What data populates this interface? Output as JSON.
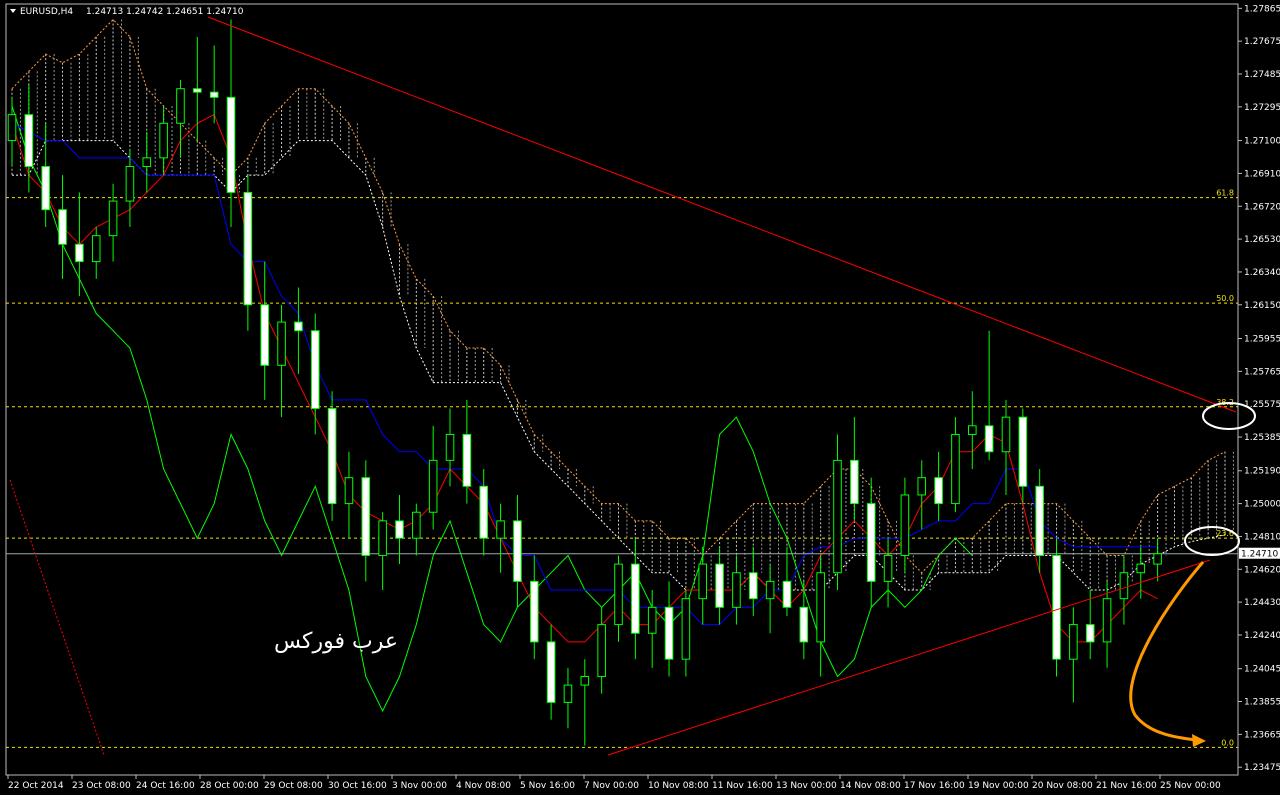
{
  "header": {
    "symbol": "EURUSD,H4",
    "ohlc": "1.24713 1.24742 1.24651 1.24710"
  },
  "watermark": "عرب فوركس",
  "colors": {
    "background": "#000000",
    "bull": "#ffffcc",
    "bear": "#ffffff",
    "kijun": "#0000ff",
    "tenkan": "#ff0000",
    "chikou": "#00ff00",
    "cloud": "#ffffff",
    "cloud_alt": "#ffa040",
    "fib": "#f2e500",
    "trend": "#ff0000",
    "arrow": "#ff9900",
    "circle": "#ffffff"
  },
  "chart_data": {
    "type": "candlestick",
    "y_ticks": [
      "1.27865",
      "1.27675",
      "1.27485",
      "1.27295",
      "1.27100",
      "1.26910",
      "1.26720",
      "1.26530",
      "1.26340",
      "1.26150",
      "1.25955",
      "1.25765",
      "1.25575",
      "1.25385",
      "1.25190",
      "1.25000",
      "1.24810",
      "1.24620",
      "1.24430",
      "1.24240",
      "1.24045",
      "1.23855",
      "1.23665",
      "1.23475"
    ],
    "ylim": [
      1.2343,
      1.2789
    ],
    "x_ticks": [
      "22 Oct 2014",
      "23 Oct 08:00",
      "24 Oct 16:00",
      "28 Oct 00:00",
      "29 Oct 08:00",
      "30 Oct 16:00",
      "3 Nov 00:00",
      "4 Nov 08:00",
      "5 Nov 16:00",
      "7 Nov 00:00",
      "10 Nov 08:00",
      "11 Nov 16:00",
      "13 Nov 00:00",
      "14 Nov 08:00",
      "17 Nov 16:00",
      "19 Nov 00:00",
      "20 Nov 08:00",
      "21 Nov 16:00",
      "25 Nov 00:00"
    ],
    "current_price": "1.24710",
    "fib_levels": [
      {
        "label": "61.8",
        "price": 1.2677
      },
      {
        "label": "50.0",
        "price": 1.2616
      },
      {
        "label": "38.2",
        "price": 1.2556
      },
      {
        "label": "23.6",
        "price": 1.248
      },
      {
        "label": "0.0",
        "price": 1.2359
      }
    ],
    "candles": [
      {
        "o": 1.271,
        "h": 1.2735,
        "l": 1.2695,
        "c": 1.2725
      },
      {
        "o": 1.2725,
        "h": 1.2742,
        "l": 1.268,
        "c": 1.2695
      },
      {
        "o": 1.2695,
        "h": 1.272,
        "l": 1.266,
        "c": 1.267
      },
      {
        "o": 1.267,
        "h": 1.269,
        "l": 1.263,
        "c": 1.265
      },
      {
        "o": 1.265,
        "h": 1.268,
        "l": 1.262,
        "c": 1.264
      },
      {
        "o": 1.264,
        "h": 1.266,
        "l": 1.263,
        "c": 1.2655
      },
      {
        "o": 1.2655,
        "h": 1.2685,
        "l": 1.264,
        "c": 1.2675
      },
      {
        "o": 1.2675,
        "h": 1.2705,
        "l": 1.266,
        "c": 1.2695
      },
      {
        "o": 1.2695,
        "h": 1.2715,
        "l": 1.268,
        "c": 1.27
      },
      {
        "o": 1.27,
        "h": 1.273,
        "l": 1.269,
        "c": 1.272
      },
      {
        "o": 1.272,
        "h": 1.2745,
        "l": 1.27,
        "c": 1.274
      },
      {
        "o": 1.274,
        "h": 1.277,
        "l": 1.271,
        "c": 1.2738
      },
      {
        "o": 1.2738,
        "h": 1.2765,
        "l": 1.272,
        "c": 1.2735
      },
      {
        "o": 1.2735,
        "h": 1.278,
        "l": 1.266,
        "c": 1.268
      },
      {
        "o": 1.268,
        "h": 1.269,
        "l": 1.26,
        "c": 1.2615
      },
      {
        "o": 1.2615,
        "h": 1.264,
        "l": 1.256,
        "c": 1.258
      },
      {
        "o": 1.258,
        "h": 1.2615,
        "l": 1.255,
        "c": 1.2605
      },
      {
        "o": 1.2605,
        "h": 1.2625,
        "l": 1.2575,
        "c": 1.26
      },
      {
        "o": 1.26,
        "h": 1.261,
        "l": 1.254,
        "c": 1.2555
      },
      {
        "o": 1.2555,
        "h": 1.2565,
        "l": 1.249,
        "c": 1.25
      },
      {
        "o": 1.25,
        "h": 1.253,
        "l": 1.248,
        "c": 1.2515
      },
      {
        "o": 1.2515,
        "h": 1.2525,
        "l": 1.2455,
        "c": 1.247
      },
      {
        "o": 1.247,
        "h": 1.2495,
        "l": 1.245,
        "c": 1.249
      },
      {
        "o": 1.249,
        "h": 1.2505,
        "l": 1.2465,
        "c": 1.248
      },
      {
        "o": 1.248,
        "h": 1.25,
        "l": 1.247,
        "c": 1.2495
      },
      {
        "o": 1.2495,
        "h": 1.2545,
        "l": 1.2485,
        "c": 1.2525
      },
      {
        "o": 1.2525,
        "h": 1.2555,
        "l": 1.251,
        "c": 1.254
      },
      {
        "o": 1.254,
        "h": 1.256,
        "l": 1.25,
        "c": 1.251
      },
      {
        "o": 1.251,
        "h": 1.252,
        "l": 1.247,
        "c": 1.248
      },
      {
        "o": 1.248,
        "h": 1.25,
        "l": 1.246,
        "c": 1.249
      },
      {
        "o": 1.249,
        "h": 1.2505,
        "l": 1.244,
        "c": 1.2455
      },
      {
        "o": 1.2455,
        "h": 1.247,
        "l": 1.241,
        "c": 1.242
      },
      {
        "o": 1.242,
        "h": 1.243,
        "l": 1.2375,
        "c": 1.2385
      },
      {
        "o": 1.2385,
        "h": 1.2405,
        "l": 1.237,
        "c": 1.2395
      },
      {
        "o": 1.2395,
        "h": 1.241,
        "l": 1.236,
        "c": 1.24
      },
      {
        "o": 1.24,
        "h": 1.244,
        "l": 1.239,
        "c": 1.243
      },
      {
        "o": 1.243,
        "h": 1.247,
        "l": 1.242,
        "c": 1.2465
      },
      {
        "o": 1.2465,
        "h": 1.248,
        "l": 1.241,
        "c": 1.2425
      },
      {
        "o": 1.2425,
        "h": 1.245,
        "l": 1.2405,
        "c": 1.244
      },
      {
        "o": 1.244,
        "h": 1.2455,
        "l": 1.24,
        "c": 1.241
      },
      {
        "o": 1.241,
        "h": 1.245,
        "l": 1.24,
        "c": 1.2445
      },
      {
        "o": 1.2445,
        "h": 1.2475,
        "l": 1.243,
        "c": 1.2465
      },
      {
        "o": 1.2465,
        "h": 1.2475,
        "l": 1.243,
        "c": 1.244
      },
      {
        "o": 1.244,
        "h": 1.247,
        "l": 1.243,
        "c": 1.246
      },
      {
        "o": 1.246,
        "h": 1.2475,
        "l": 1.2435,
        "c": 1.2445
      },
      {
        "o": 1.2445,
        "h": 1.2465,
        "l": 1.2425,
        "c": 1.2455
      },
      {
        "o": 1.2455,
        "h": 1.2475,
        "l": 1.2435,
        "c": 1.244
      },
      {
        "o": 1.244,
        "h": 1.2455,
        "l": 1.241,
        "c": 1.242
      },
      {
        "o": 1.242,
        "h": 1.247,
        "l": 1.24,
        "c": 1.246
      },
      {
        "o": 1.246,
        "h": 1.254,
        "l": 1.245,
        "c": 1.2525
      },
      {
        "o": 1.2525,
        "h": 1.255,
        "l": 1.249,
        "c": 1.25
      },
      {
        "o": 1.25,
        "h": 1.2515,
        "l": 1.244,
        "c": 1.2455
      },
      {
        "o": 1.2455,
        "h": 1.248,
        "l": 1.244,
        "c": 1.247
      },
      {
        "o": 1.247,
        "h": 1.2515,
        "l": 1.246,
        "c": 1.2505
      },
      {
        "o": 1.2505,
        "h": 1.2525,
        "l": 1.2485,
        "c": 1.2515
      },
      {
        "o": 1.2515,
        "h": 1.253,
        "l": 1.249,
        "c": 1.25
      },
      {
        "o": 1.25,
        "h": 1.255,
        "l": 1.2495,
        "c": 1.254
      },
      {
        "o": 1.254,
        "h": 1.2565,
        "l": 1.252,
        "c": 1.2545
      },
      {
        "o": 1.2545,
        "h": 1.26,
        "l": 1.2525,
        "c": 1.253
      },
      {
        "o": 1.253,
        "h": 1.256,
        "l": 1.2505,
        "c": 1.255
      },
      {
        "o": 1.255,
        "h": 1.2555,
        "l": 1.25,
        "c": 1.251
      },
      {
        "o": 1.251,
        "h": 1.252,
        "l": 1.246,
        "c": 1.247
      },
      {
        "o": 1.247,
        "h": 1.248,
        "l": 1.24,
        "c": 1.241
      },
      {
        "o": 1.241,
        "h": 1.244,
        "l": 1.2385,
        "c": 1.243
      },
      {
        "o": 1.243,
        "h": 1.245,
        "l": 1.241,
        "c": 1.242
      },
      {
        "o": 1.242,
        "h": 1.2455,
        "l": 1.2405,
        "c": 1.2445
      },
      {
        "o": 1.2445,
        "h": 1.247,
        "l": 1.243,
        "c": 1.246
      },
      {
        "o": 1.246,
        "h": 1.2475,
        "l": 1.2445,
        "c": 1.2465
      },
      {
        "o": 1.2465,
        "h": 1.248,
        "l": 1.2455,
        "c": 1.2471
      }
    ],
    "kijun": [
      1.272,
      1.2715,
      1.271,
      1.271,
      1.27,
      1.27,
      1.27,
      1.27,
      1.269,
      1.269,
      1.269,
      1.269,
      1.269,
      1.265,
      1.264,
      1.264,
      1.262,
      1.261,
      1.258,
      1.256,
      1.256,
      1.256,
      1.254,
      1.253,
      1.253,
      1.252,
      1.252,
      1.252,
      1.251,
      1.248,
      1.247,
      1.247,
      1.245,
      1.245,
      1.245,
      1.245,
      1.245,
      1.244,
      1.244,
      1.244,
      1.244,
      1.243,
      1.243,
      1.244,
      1.244,
      1.245,
      1.245,
      1.247,
      1.2475,
      1.2475,
      1.248,
      1.248,
      1.248,
      1.248,
      1.2485,
      1.249,
      1.249,
      1.25,
      1.25,
      1.252,
      1.252,
      1.249,
      1.248,
      1.2475,
      1.2475,
      1.2475,
      1.2475,
      1.2475,
      1.2475
    ],
    "tenkan": [
      1.272,
      1.269,
      1.268,
      1.266,
      1.265,
      1.266,
      1.2665,
      1.267,
      1.268,
      1.269,
      1.271,
      1.272,
      1.2725,
      1.27,
      1.265,
      1.261,
      1.259,
      1.257,
      1.255,
      1.253,
      1.2505,
      1.2495,
      1.249,
      1.2485,
      1.249,
      1.25,
      1.252,
      1.251,
      1.25,
      1.248,
      1.246,
      1.244,
      1.243,
      1.242,
      1.242,
      1.243,
      1.244,
      1.243,
      1.243,
      1.244,
      1.245,
      1.245,
      1.245,
      1.245,
      1.246,
      1.245,
      1.244,
      1.245,
      1.247,
      1.248,
      1.249,
      1.248,
      1.247,
      1.248,
      1.25,
      1.251,
      1.253,
      1.253,
      1.254,
      1.2535,
      1.25,
      1.246,
      1.243,
      1.242,
      1.242,
      1.243,
      1.244,
      1.245,
      1.2445
    ],
    "chikou": [
      1.273,
      1.27,
      1.268,
      1.265,
      1.263,
      1.261,
      1.26,
      1.259,
      1.256,
      1.252,
      1.25,
      1.248,
      1.25,
      1.254,
      1.252,
      1.249,
      1.247,
      1.249,
      1.251,
      1.248,
      1.245,
      1.24,
      1.238,
      1.24,
      1.243,
      1.247,
      1.249,
      1.246,
      1.243,
      1.242,
      1.244,
      1.245,
      1.246,
      1.247,
      1.245,
      1.244,
      1.245,
      1.246,
      1.244,
      1.243,
      1.244,
      1.247,
      1.254,
      1.255,
      1.253,
      1.25,
      1.248,
      1.245,
      1.242,
      1.24,
      1.241,
      1.244,
      1.245,
      1.244,
      1.245,
      1.247,
      1.248,
      1.247
    ],
    "cloud_a": [
      1.274,
      1.275,
      1.276,
      1.2755,
      1.276,
      1.277,
      1.278,
      1.277,
      1.274,
      1.273,
      1.272,
      1.271,
      1.27,
      1.269,
      1.27,
      1.272,
      1.273,
      1.274,
      1.274,
      1.273,
      1.272,
      1.27,
      1.268,
      1.265,
      1.263,
      1.262,
      1.26,
      1.259,
      1.259,
      1.258,
      1.256,
      1.254,
      1.253,
      1.252,
      1.251,
      1.25,
      1.25,
      1.249,
      1.249,
      1.248,
      1.248,
      1.247,
      1.248,
      1.249,
      1.25,
      1.25,
      1.25,
      1.25,
      1.251,
      1.252,
      1.252,
      1.251,
      1.249,
      1.247,
      1.246,
      1.247,
      1.248,
      1.248,
      1.249,
      1.25,
      1.25,
      1.25,
      1.25,
      1.249,
      1.248,
      1.247,
      1.247,
      1.249,
      1.2505,
      1.251,
      1.2515,
      1.2525,
      1.253,
      1.253
    ],
    "cloud_b": [
      1.269,
      1.269,
      1.271,
      1.271,
      1.271,
      1.271,
      1.271,
      1.27,
      1.269,
      1.269,
      1.269,
      1.269,
      1.269,
      1.268,
      1.269,
      1.269,
      1.27,
      1.271,
      1.271,
      1.271,
      1.27,
      1.269,
      1.266,
      1.262,
      1.259,
      1.257,
      1.257,
      1.257,
      1.257,
      1.257,
      1.255,
      1.253,
      1.252,
      1.251,
      1.25,
      1.249,
      1.248,
      1.247,
      1.246,
      1.246,
      1.245,
      1.245,
      1.245,
      1.245,
      1.246,
      1.245,
      1.245,
      1.245,
      1.245,
      1.246,
      1.247,
      1.247,
      1.246,
      1.245,
      1.245,
      1.246,
      1.246,
      1.246,
      1.246,
      1.247,
      1.247,
      1.247,
      1.247,
      1.246,
      1.245,
      1.245,
      1.2455,
      1.2465,
      1.247,
      1.2475,
      1.2478,
      1.248,
      1.2482,
      1.2484
    ]
  }
}
